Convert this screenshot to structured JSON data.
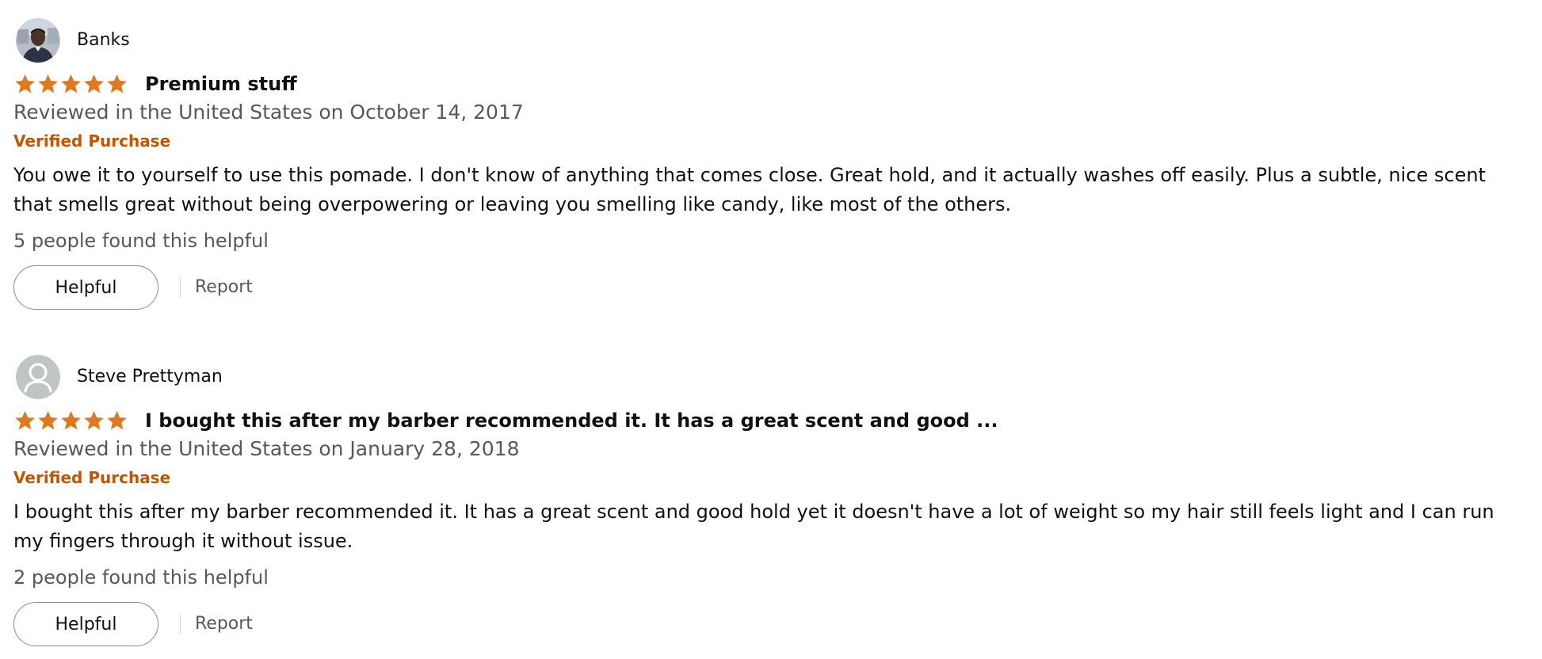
{
  "colors": {
    "star": "#de7921",
    "verified": "#c45500",
    "secondary_text": "#565959",
    "primary_text": "#0f1111"
  },
  "reviews": [
    {
      "profile_name": "Banks",
      "avatar": "profile-photo",
      "rating": 5,
      "title": "Premium stuff",
      "date": "Reviewed in the United States on October 14, 2017",
      "verified": "Verified Purchase",
      "body": "You owe it to yourself to use this pomade. I don't know of anything that comes close. Great hold, and it actually washes off easily. Plus a subtle, nice scent that smells great without being overpowering or leaving you smelling like candy, like most of the others.",
      "helpful_count": "5 people found this helpful",
      "helpful_label": "Helpful",
      "report_label": "Report"
    },
    {
      "profile_name": "Steve Prettyman",
      "avatar": "default-avatar-icon",
      "rating": 5,
      "title": "I bought this after my barber recommended it. It has a great scent and good ...",
      "date": "Reviewed in the United States on January 28, 2018",
      "verified": "Verified Purchase",
      "body": "I bought this after my barber recommended it. It has a great scent and good hold yet it doesn't have a lot of weight so my hair still feels light and I can run my fingers through it without issue.",
      "helpful_count": "2 people found this helpful",
      "helpful_label": "Helpful",
      "report_label": "Report"
    }
  ]
}
